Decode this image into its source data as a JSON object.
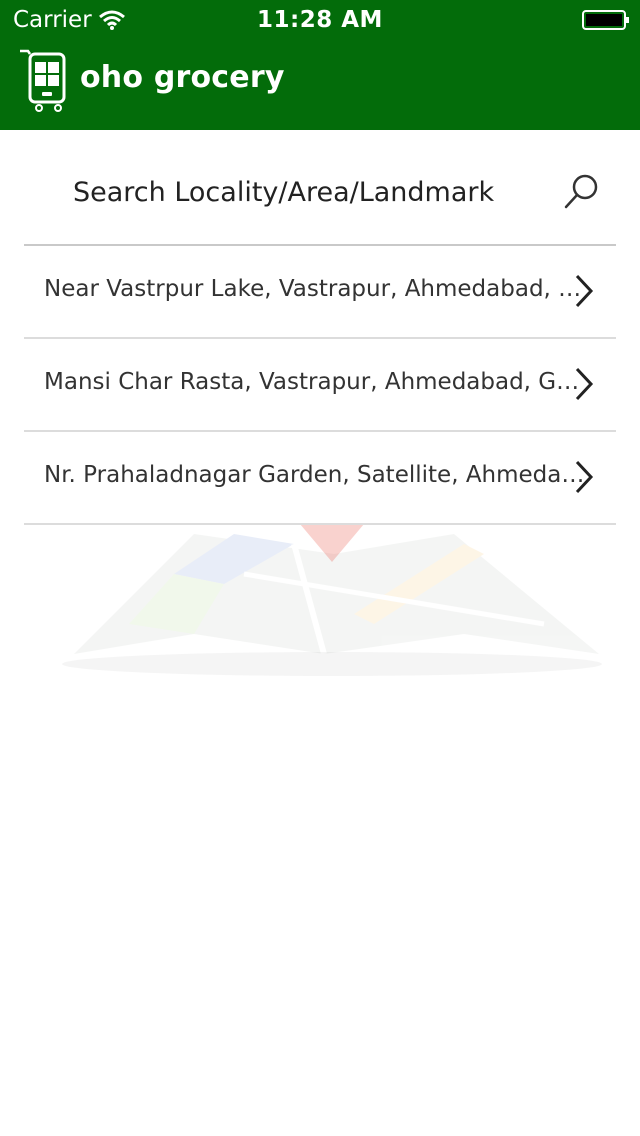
{
  "status_bar": {
    "carrier": "Carrier",
    "time": "11:28 AM"
  },
  "app": {
    "name": "oho grocery",
    "brand_color": "#036c0a"
  },
  "search": {
    "placeholder": "Search Locality/Area/Landmark",
    "value": ""
  },
  "locations": [
    {
      "label": "Near Vastrpur Lake, Vastrapur, Ahmedabad, Gujarat"
    },
    {
      "label": "Mansi Char Rasta, Vastrapur, Ahmedabad, Gujarat"
    },
    {
      "label": "Nr. Prahaladnagar Garden, Satellite, Ahmedabad, Gujarat"
    }
  ],
  "icons": {
    "logo": "phone-cart-icon",
    "search": "search-icon",
    "row": "chevron-right-icon",
    "background": "map-icon"
  }
}
